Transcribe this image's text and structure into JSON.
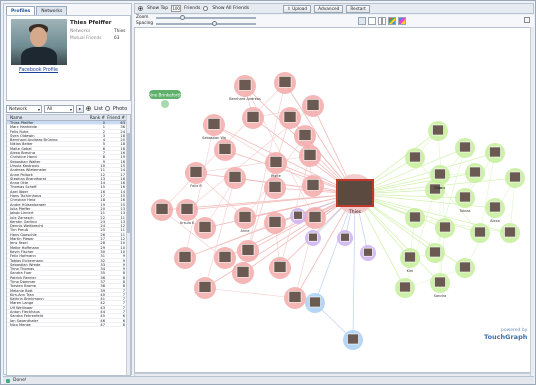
{
  "tabs": [
    {
      "label": "Profiles",
      "active": true
    },
    {
      "label": "Networks",
      "active": false
    }
  ],
  "profile": {
    "name": "Thies Pfeiffer",
    "fields": [
      {
        "key": "Networks",
        "value": "Thies"
      },
      {
        "key": "Mutual Friends",
        "value": "63"
      }
    ],
    "link": "Facebook Profile"
  },
  "filter": {
    "network": "Network",
    "all": "All",
    "go": "▸",
    "mode_list": "List",
    "mode_photo": "Photo"
  },
  "table": {
    "headers": [
      "Name",
      "Rank #",
      "Friend #"
    ],
    "rows": [
      [
        "Thies Pfeiffer",
        "0",
        "63"
      ],
      [
        "Marc Hanheide",
        "1",
        "36"
      ],
      [
        "Felix Ruhe",
        "2",
        "24"
      ],
      [
        "Sven Oldewin",
        "3",
        "18"
      ],
      [
        "Bernhard Andreas Brüning",
        "4",
        "20"
      ],
      [
        "Niklas Belter",
        "5",
        "18"
      ],
      [
        "Malte Gebel",
        "6",
        "18"
      ],
      [
        "Alexa Breuing",
        "7",
        "16"
      ],
      [
        "Christine Hand",
        "8",
        "19"
      ],
      [
        "Sebastian Walter",
        "9",
        "16"
      ],
      [
        "Ursula Kastrouis",
        "10",
        "15"
      ],
      [
        "Andreas Wietemeier",
        "11",
        "14"
      ],
      [
        "Anne Pollock",
        "12",
        "17"
      ],
      [
        "Stephan Brandhorst",
        "13",
        "16"
      ],
      [
        "Anna Otte",
        "14",
        "16"
      ],
      [
        "Thomas Scheff",
        "15",
        "16"
      ],
      [
        "Axel Jäger",
        "16",
        "14"
      ],
      [
        "Hans Tschirnhaus",
        "17",
        "15"
      ],
      [
        "Christian Heid",
        "18",
        "16"
      ],
      [
        "Andre Hülsenberger",
        "19",
        "15"
      ],
      [
        "Julia Pfeffer",
        "20",
        "13"
      ],
      [
        "Jakob Linnert",
        "21",
        "13"
      ],
      [
        "Jule Zarrasch",
        "22",
        "11"
      ],
      [
        "Kerstin Gerling",
        "23",
        "13"
      ],
      [
        "Dennis Weitbrecht",
        "24",
        "12"
      ],
      [
        "Tim Preuß",
        "25",
        "11"
      ],
      [
        "Hans Goeschle",
        "26",
        "11"
      ],
      [
        "Martin Pieper",
        "27",
        "12"
      ],
      [
        "Jens Fasel",
        "28",
        "10"
      ],
      [
        "Meike Hoffmann",
        "29",
        "10"
      ],
      [
        "Kevin Fischer",
        "30",
        "10"
      ],
      [
        "Felix Hofmann",
        "31",
        "9"
      ],
      [
        "Tobias Eickermann",
        "32",
        "9"
      ],
      [
        "Sebastian Wrede",
        "33",
        "9"
      ],
      [
        "Timo Thomas",
        "34",
        "9"
      ],
      [
        "Sandra Fuer",
        "35",
        "8"
      ],
      [
        "Patrick Renner",
        "36",
        "8"
      ],
      [
        "Timo Dammer",
        "37",
        "8"
      ],
      [
        "Torsten Brome",
        "38",
        "8"
      ],
      [
        "Melanie Bott",
        "39",
        "7"
      ],
      [
        "Kim-Ann Tran",
        "40",
        "7"
      ],
      [
        "Kathrin Brinkmann",
        "41",
        "7"
      ],
      [
        "Maren Lange",
        "42",
        "7"
      ],
      [
        "Ulf Wellinger",
        "43",
        "7"
      ],
      [
        "Anton Fleckhaus",
        "44",
        "7"
      ],
      [
        "Sandra Fehrenfeld",
        "45",
        "6"
      ],
      [
        "Jan Saxenthaler",
        "46",
        "6"
      ],
      [
        "Nico Menke",
        "47",
        "6"
      ]
    ]
  },
  "toolbar": {
    "show_top": "Show Top",
    "top_count": "100",
    "friends": "Friends",
    "show_all": "Show All Friends",
    "upload": "Upload",
    "advanced": "Advanced",
    "restart": "Restart"
  },
  "sliders": {
    "zoom": "Zoom",
    "spacing": "Spacing"
  },
  "status": "Done!",
  "brand": {
    "line1": "powered by",
    "line2": "TouchGraph"
  },
  "colors": {
    "red_cluster": "#f3a9a9",
    "green_cluster": "#c6ef9a",
    "blue_cluster": "#a9cff3",
    "purple_cluster": "#cdb2ef",
    "center": "#c0392b"
  },
  "graph_labels": {
    "center": "Thies",
    "lone": "Sine Brinkeforth",
    "nodes": [
      "Bernhard Andreas",
      "Sebastian Wa",
      "Felix R",
      "Malte",
      "Ursula K",
      "Anne",
      "Timo",
      "Tobias",
      "Marco",
      "Alexa",
      "Kim",
      "Sandra"
    ]
  }
}
